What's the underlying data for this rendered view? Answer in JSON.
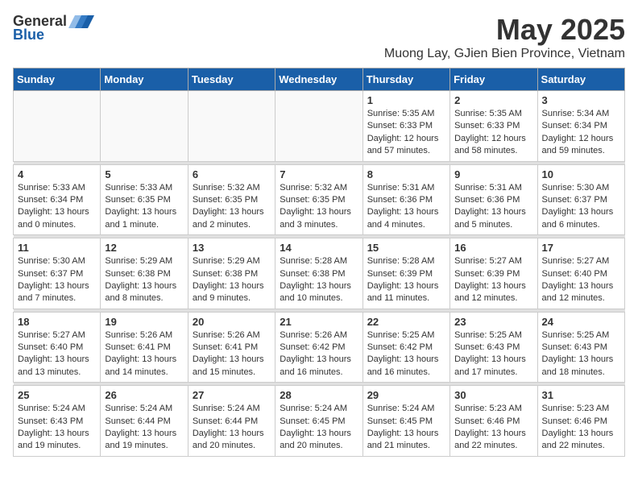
{
  "header": {
    "logo_general": "General",
    "logo_blue": "Blue",
    "month_title": "May 2025",
    "location": "Muong Lay, GJien Bien Province, Vietnam"
  },
  "days_of_week": [
    "Sunday",
    "Monday",
    "Tuesday",
    "Wednesday",
    "Thursday",
    "Friday",
    "Saturday"
  ],
  "weeks": [
    [
      {
        "day": "",
        "detail": ""
      },
      {
        "day": "",
        "detail": ""
      },
      {
        "day": "",
        "detail": ""
      },
      {
        "day": "",
        "detail": ""
      },
      {
        "day": "1",
        "detail": "Sunrise: 5:35 AM\nSunset: 6:33 PM\nDaylight: 12 hours\nand 57 minutes."
      },
      {
        "day": "2",
        "detail": "Sunrise: 5:35 AM\nSunset: 6:33 PM\nDaylight: 12 hours\nand 58 minutes."
      },
      {
        "day": "3",
        "detail": "Sunrise: 5:34 AM\nSunset: 6:34 PM\nDaylight: 12 hours\nand 59 minutes."
      }
    ],
    [
      {
        "day": "4",
        "detail": "Sunrise: 5:33 AM\nSunset: 6:34 PM\nDaylight: 13 hours\nand 0 minutes."
      },
      {
        "day": "5",
        "detail": "Sunrise: 5:33 AM\nSunset: 6:35 PM\nDaylight: 13 hours\nand 1 minute."
      },
      {
        "day": "6",
        "detail": "Sunrise: 5:32 AM\nSunset: 6:35 PM\nDaylight: 13 hours\nand 2 minutes."
      },
      {
        "day": "7",
        "detail": "Sunrise: 5:32 AM\nSunset: 6:35 PM\nDaylight: 13 hours\nand 3 minutes."
      },
      {
        "day": "8",
        "detail": "Sunrise: 5:31 AM\nSunset: 6:36 PM\nDaylight: 13 hours\nand 4 minutes."
      },
      {
        "day": "9",
        "detail": "Sunrise: 5:31 AM\nSunset: 6:36 PM\nDaylight: 13 hours\nand 5 minutes."
      },
      {
        "day": "10",
        "detail": "Sunrise: 5:30 AM\nSunset: 6:37 PM\nDaylight: 13 hours\nand 6 minutes."
      }
    ],
    [
      {
        "day": "11",
        "detail": "Sunrise: 5:30 AM\nSunset: 6:37 PM\nDaylight: 13 hours\nand 7 minutes."
      },
      {
        "day": "12",
        "detail": "Sunrise: 5:29 AM\nSunset: 6:38 PM\nDaylight: 13 hours\nand 8 minutes."
      },
      {
        "day": "13",
        "detail": "Sunrise: 5:29 AM\nSunset: 6:38 PM\nDaylight: 13 hours\nand 9 minutes."
      },
      {
        "day": "14",
        "detail": "Sunrise: 5:28 AM\nSunset: 6:38 PM\nDaylight: 13 hours\nand 10 minutes."
      },
      {
        "day": "15",
        "detail": "Sunrise: 5:28 AM\nSunset: 6:39 PM\nDaylight: 13 hours\nand 11 minutes."
      },
      {
        "day": "16",
        "detail": "Sunrise: 5:27 AM\nSunset: 6:39 PM\nDaylight: 13 hours\nand 12 minutes."
      },
      {
        "day": "17",
        "detail": "Sunrise: 5:27 AM\nSunset: 6:40 PM\nDaylight: 13 hours\nand 12 minutes."
      }
    ],
    [
      {
        "day": "18",
        "detail": "Sunrise: 5:27 AM\nSunset: 6:40 PM\nDaylight: 13 hours\nand 13 minutes."
      },
      {
        "day": "19",
        "detail": "Sunrise: 5:26 AM\nSunset: 6:41 PM\nDaylight: 13 hours\nand 14 minutes."
      },
      {
        "day": "20",
        "detail": "Sunrise: 5:26 AM\nSunset: 6:41 PM\nDaylight: 13 hours\nand 15 minutes."
      },
      {
        "day": "21",
        "detail": "Sunrise: 5:26 AM\nSunset: 6:42 PM\nDaylight: 13 hours\nand 16 minutes."
      },
      {
        "day": "22",
        "detail": "Sunrise: 5:25 AM\nSunset: 6:42 PM\nDaylight: 13 hours\nand 16 minutes."
      },
      {
        "day": "23",
        "detail": "Sunrise: 5:25 AM\nSunset: 6:43 PM\nDaylight: 13 hours\nand 17 minutes."
      },
      {
        "day": "24",
        "detail": "Sunrise: 5:25 AM\nSunset: 6:43 PM\nDaylight: 13 hours\nand 18 minutes."
      }
    ],
    [
      {
        "day": "25",
        "detail": "Sunrise: 5:24 AM\nSunset: 6:43 PM\nDaylight: 13 hours\nand 19 minutes."
      },
      {
        "day": "26",
        "detail": "Sunrise: 5:24 AM\nSunset: 6:44 PM\nDaylight: 13 hours\nand 19 minutes."
      },
      {
        "day": "27",
        "detail": "Sunrise: 5:24 AM\nSunset: 6:44 PM\nDaylight: 13 hours\nand 20 minutes."
      },
      {
        "day": "28",
        "detail": "Sunrise: 5:24 AM\nSunset: 6:45 PM\nDaylight: 13 hours\nand 20 minutes."
      },
      {
        "day": "29",
        "detail": "Sunrise: 5:24 AM\nSunset: 6:45 PM\nDaylight: 13 hours\nand 21 minutes."
      },
      {
        "day": "30",
        "detail": "Sunrise: 5:23 AM\nSunset: 6:46 PM\nDaylight: 13 hours\nand 22 minutes."
      },
      {
        "day": "31",
        "detail": "Sunrise: 5:23 AM\nSunset: 6:46 PM\nDaylight: 13 hours\nand 22 minutes."
      }
    ]
  ]
}
